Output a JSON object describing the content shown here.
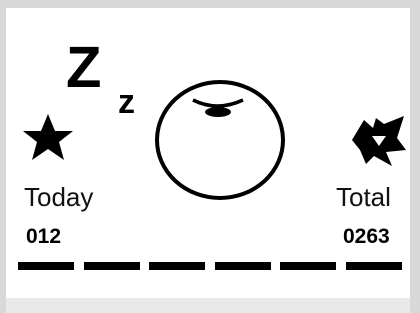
{
  "sleep": {
    "today_label": "Today",
    "today_value": "012",
    "total_label": "Total",
    "total_value": "0263",
    "sleep_symbol_big": "Z",
    "sleep_symbol_small": "z",
    "progress_segments": 6
  },
  "icons": {
    "today": "star-icon",
    "total": "star-burst-icon",
    "pet": "sleeping-face-icon"
  },
  "colors": {
    "screen_bg": "#ffffff",
    "ink": "#000000"
  }
}
